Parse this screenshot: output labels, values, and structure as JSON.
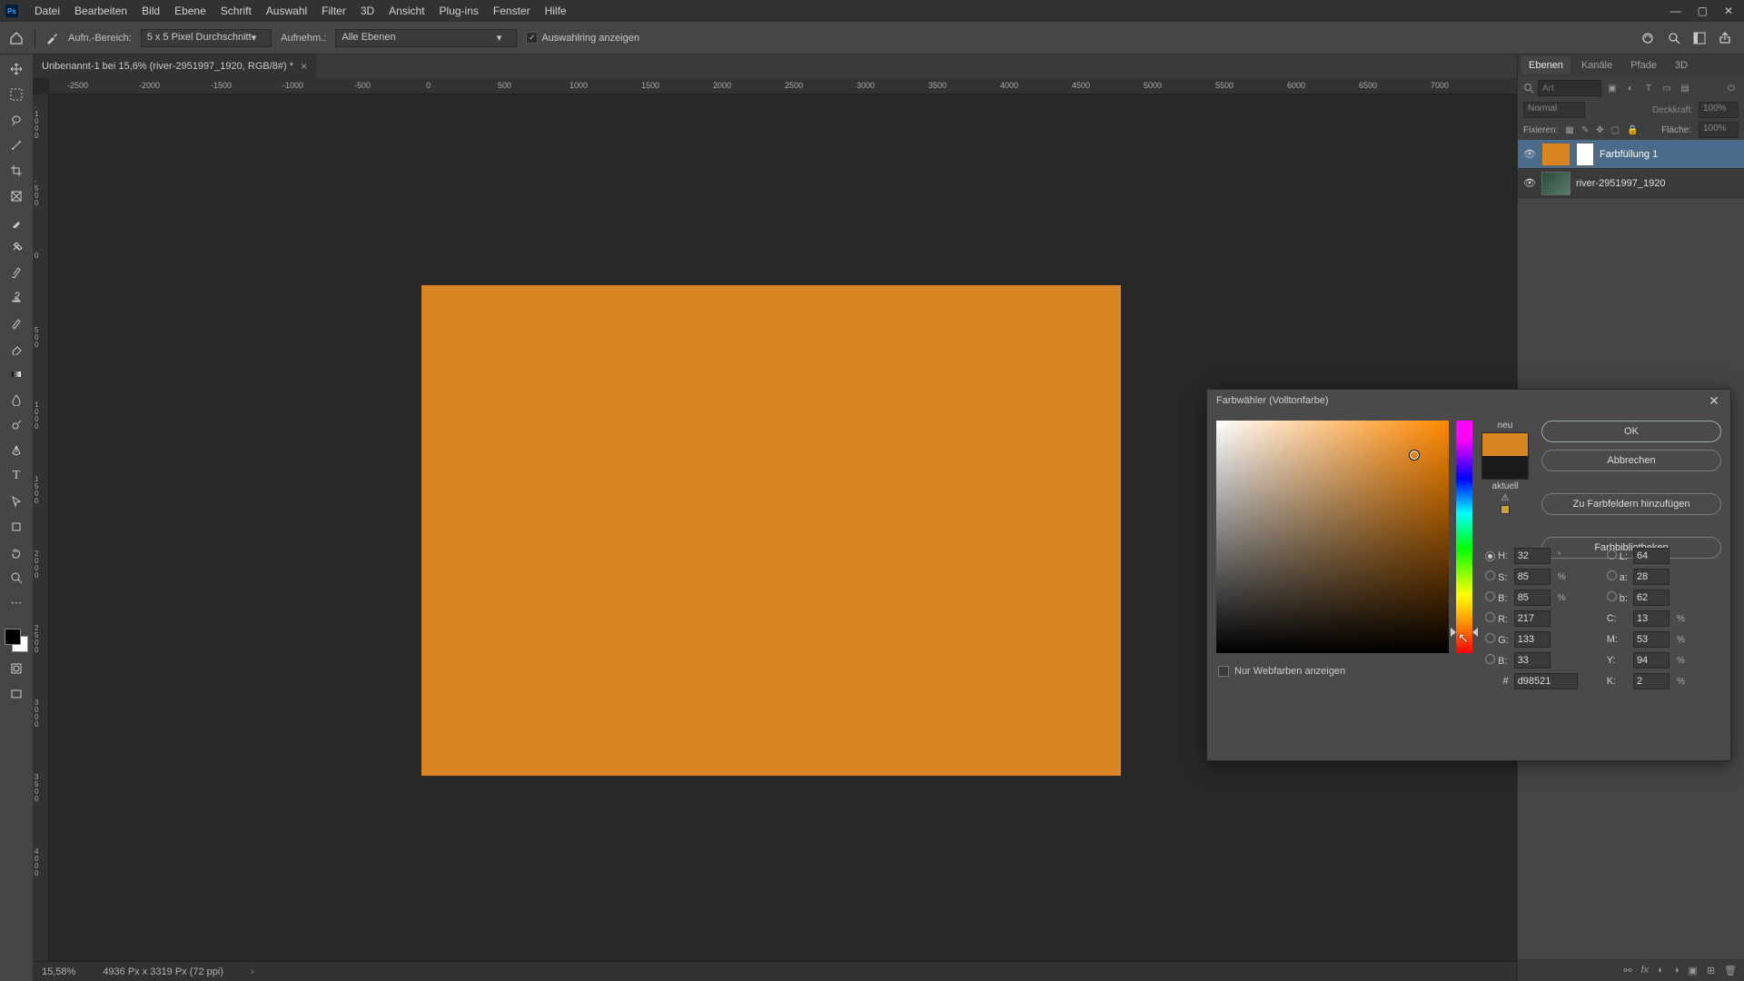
{
  "app": {
    "logo": "Ps"
  },
  "menu": [
    "Datei",
    "Bearbeiten",
    "Bild",
    "Ebene",
    "Schrift",
    "Auswahl",
    "Filter",
    "3D",
    "Ansicht",
    "Plug-ins",
    "Fenster",
    "Hilfe"
  ],
  "options": {
    "sample_label": "Aufn.-Bereich:",
    "sample_value": "5 x 5 Pixel Durchschnitt",
    "layers_label": "Aufnehm.:",
    "layers_value": "Alle Ebenen",
    "show_ring_label": "Auswahlring anzeigen"
  },
  "document": {
    "tab_title": "Unbenannt-1 bei 15,6% (river-2951997_1920, RGB/8#) *"
  },
  "ruler_h": [
    "-2500",
    "-2000",
    "-1500",
    "-1000",
    "-500",
    "0",
    "500",
    "1000",
    "1500",
    "2000",
    "2500",
    "3000",
    "3500",
    "4000",
    "4500",
    "5000",
    "5500",
    "6000",
    "6500",
    "7000"
  ],
  "ruler_v": [
    "-1000",
    "-500",
    "0",
    "500",
    "1000",
    "1500",
    "2000",
    "2500",
    "3000",
    "3500",
    "4000"
  ],
  "status": {
    "zoom": "15,58%",
    "info": "4936 Px x 3319 Px (72 ppi)"
  },
  "panels": {
    "tabs": [
      "Ebenen",
      "Kanäle",
      "Pfade",
      "3D"
    ],
    "search_placeholder": "Art",
    "blend_mode": "Normal",
    "opacity_label": "Deckkraft:",
    "opacity_value": "100%",
    "lock_label": "Fixieren:",
    "fill_label": "Fläche:",
    "fill_value": "100%",
    "layers": [
      {
        "name": "Farbfüllung 1",
        "selected": true,
        "type": "fill"
      },
      {
        "name": "river-2951997_1920",
        "selected": false,
        "type": "image"
      }
    ]
  },
  "picker": {
    "title": "Farbwähler (Volltonfarbe)",
    "ok": "OK",
    "cancel": "Abbrechen",
    "add_swatch": "Zu Farbfeldern hinzufügen",
    "libraries": "Farbbibliotheken",
    "new_label": "neu",
    "current_label": "aktuell",
    "webonly": "Nur Webfarben anzeigen",
    "H": "32",
    "S": "85",
    "Bv": "85",
    "R": "217",
    "G": "133",
    "B": "33",
    "L": "64",
    "a": "28",
    "b": "62",
    "C": "13",
    "M": "53",
    "Y": "94",
    "K": "2",
    "hex": "d98521",
    "labels": {
      "H": "H:",
      "S": "S:",
      "Bv": "B:",
      "R": "R:",
      "G": "G:",
      "B": "B:",
      "L": "L:",
      "a": "a:",
      "b": "b:",
      "C": "C:",
      "M": "M:",
      "Y": "Y:",
      "K": "K:",
      "hex": "#",
      "deg": "°",
      "pct": "%"
    },
    "new_color": "#d98521",
    "current_color": "#1a1a1a"
  }
}
